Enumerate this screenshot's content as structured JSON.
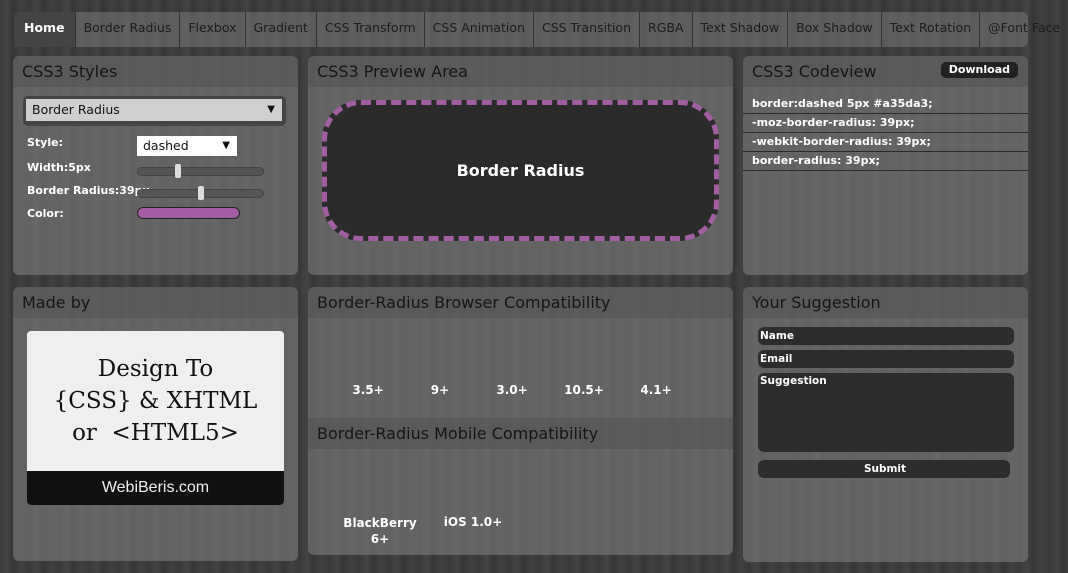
{
  "tabs": [
    "Home",
    "Border Radius",
    "Flexbox",
    "Gradient",
    "CSS Transform",
    "CSS Animation",
    "CSS Transition",
    "RGBA",
    "Text Shadow",
    "Box Shadow",
    "Text Rotation",
    "@Font Face"
  ],
  "styles": {
    "title": "CSS3 Styles",
    "property_select": "Border Radius",
    "style_label": "Style:",
    "style_value": "dashed",
    "width_label": "Width:5px",
    "width_value": 5,
    "radius_label": "Border Radius:39px",
    "radius_value": 39,
    "color_label": "Color:",
    "color": "#a35da3"
  },
  "preview": {
    "title": "CSS3 Preview Area",
    "box_text": "Border Radius"
  },
  "codeview": {
    "title": "CSS3 Codeview",
    "download": "Download",
    "lines": [
      "border:dashed 5px #a35da3;",
      "-moz-border-radius: 39px;",
      "-webkit-border-radius: 39px;",
      "border-radius: 39px;"
    ]
  },
  "madeby": {
    "title": "Made by",
    "logo_lines": [
      "Design To",
      "{CSS} & XHTML",
      "or  <HTML5>"
    ],
    "logo_footer": "WebiBeris.com"
  },
  "compat": {
    "browser_title": "Border-Radius Browser Compatibility",
    "browser_versions": [
      "3.5+",
      "9+",
      "3.0+",
      "10.5+",
      "4.1+"
    ],
    "mobile_title": "Border-Radius Mobile Compatibility",
    "mobile_versions": [
      "BlackBerry 6+",
      "iOS 1.0+"
    ]
  },
  "suggestion": {
    "title": "Your Suggestion",
    "name_placeholder": "Name",
    "email_placeholder": "Email",
    "suggestion_placeholder": "Suggestion",
    "submit": "Submit"
  }
}
